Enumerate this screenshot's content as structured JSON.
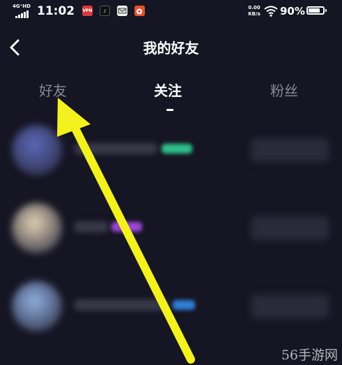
{
  "status_bar": {
    "network": "4G⁺HD",
    "time": "11:02",
    "apps": [
      {
        "icon": "vpn-app-icon",
        "label": "VPN"
      },
      {
        "icon": "tiktok-app-icon",
        "label": "♪"
      },
      {
        "icon": "mail-app-icon",
        "label": "✉"
      },
      {
        "icon": "weibo-app-icon",
        "label": "◎"
      }
    ],
    "speed_value": "0.00",
    "speed_unit": "KB/s",
    "battery_percent": "90%",
    "battery_level": 0.9
  },
  "header": {
    "back_icon": "chevron-left-icon",
    "title": "我的好友"
  },
  "tabs": [
    {
      "label": "好友",
      "active": false
    },
    {
      "label": "关注",
      "active": true
    },
    {
      "label": "粉丝",
      "active": false
    }
  ],
  "list": {
    "items": [
      {
        "avatar_color": "#5a68b8",
        "name_color": "#3a3948",
        "badge_color": "#2fbf8a"
      },
      {
        "avatar_color": "#e2d2b2",
        "name_color": "#3a3948",
        "badge_color": "#9b46d6"
      },
      {
        "avatar_color": "#8fb0e0",
        "name_color": "#3a3948",
        "badge_color": "#2f7fd6"
      }
    ]
  },
  "annotation": {
    "arrow_color": "#f4f21e"
  },
  "watermark": "56手游网",
  "colors": {
    "background": "#161523",
    "text_primary": "#ffffff",
    "text_secondary": "#8a8996"
  }
}
